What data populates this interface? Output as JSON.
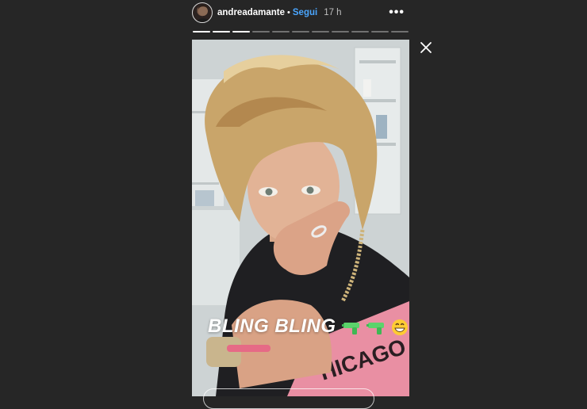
{
  "header": {
    "username": "andreadamante",
    "separator": "•",
    "follow_label": "Segui",
    "time": "17 h",
    "more_label": "•••"
  },
  "progress": {
    "total_segments": 11,
    "viewed_segments": 3
  },
  "story": {
    "caption": "BLING BLING",
    "emoji_after_caption": [
      "water-pistol-icon",
      "water-pistol-icon",
      "grinning-face-icon"
    ],
    "shirt_text": "HICAGO RA"
  },
  "colors": {
    "background": "#262626",
    "follow": "#4aa6ff",
    "shirt": "#e98fa3"
  }
}
